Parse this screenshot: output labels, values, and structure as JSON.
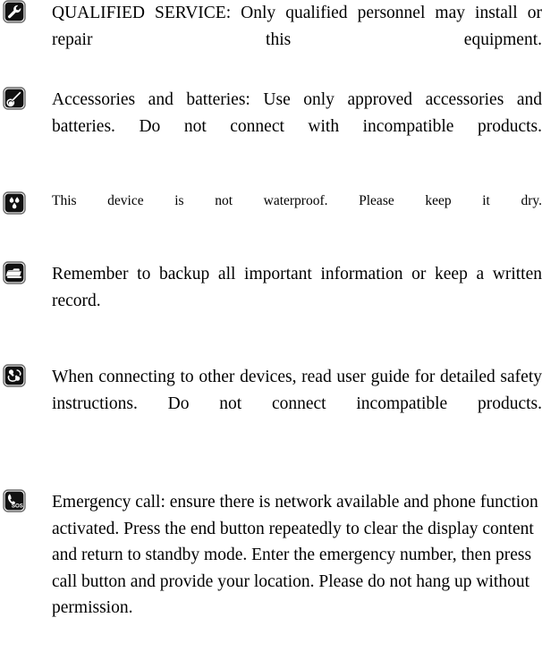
{
  "document": {
    "type": "safety-warnings-page",
    "background_color": "#ffffff",
    "text_color": "#000000"
  },
  "notices": [
    {
      "icon": "wrench-icon",
      "icon_label": "qualified-service",
      "text": "QUALIFIED SERVICE: Only qualified personnel may install or repair this equipment.",
      "align": "justify",
      "size": "normal"
    },
    {
      "icon": "battery-accessory-icon",
      "icon_label": "accessories-and-batteries",
      "text": "Accessories and batteries: Use only approved accessories and batteries. Do not connect with incompatible products.",
      "align": "justify",
      "size": "normal"
    },
    {
      "icon": "water-drops-icon",
      "icon_label": "not-waterproof",
      "text": "This device is not waterproof. Please keep it dry.",
      "align": "justify",
      "size": "small"
    },
    {
      "icon": "folder-backup-icon",
      "icon_label": "backup-information",
      "text": "Remember to backup all important information or keep a written record.",
      "align": "justify",
      "size": "normal"
    },
    {
      "icon": "connector-plug-icon",
      "icon_label": "connecting-other-devices",
      "text": "When connecting to other devices, read user guide for detailed safety instructions. Do not connect incompatible products.",
      "align": "justify",
      "size": "normal"
    },
    {
      "icon": "sos-phone-icon",
      "icon_label": "emergency-call",
      "text": "Emergency call: ensure there is network available and phone function activated. Press the end button repeatedly to clear the display content and return to standby mode. Enter the emergency number, then press call button and provide your location. Please do not hang up without permission.",
      "align": "left",
      "size": "normal"
    }
  ]
}
